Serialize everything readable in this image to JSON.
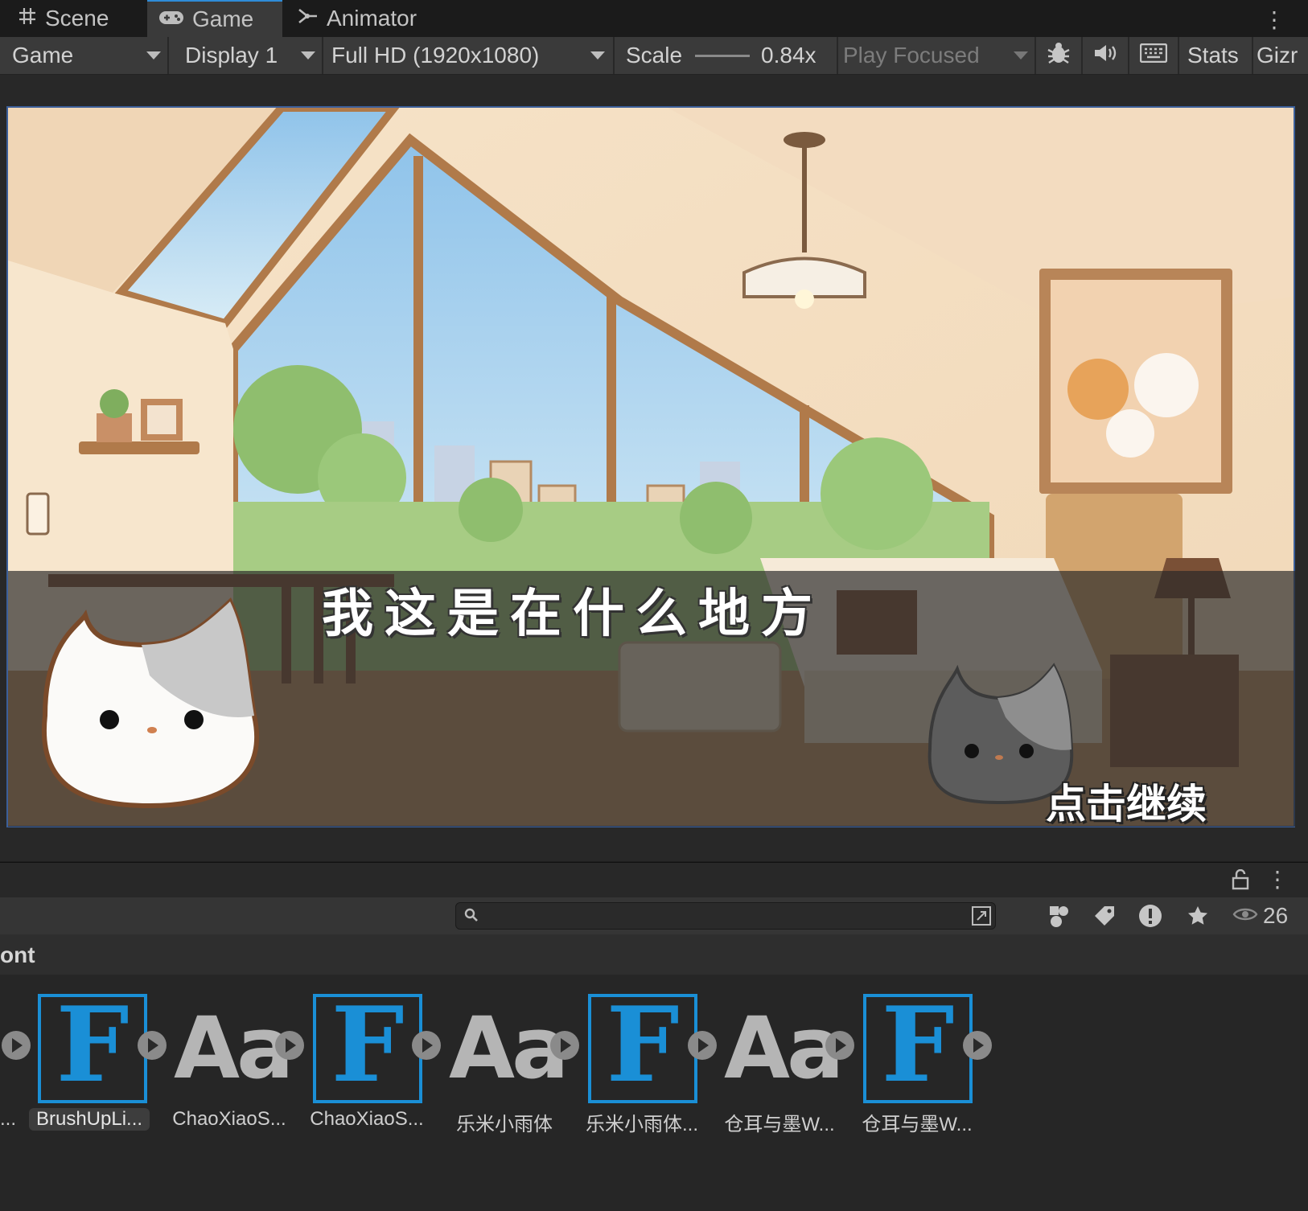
{
  "tabs": [
    {
      "label": "Scene",
      "icon": "hash-icon",
      "active": false
    },
    {
      "label": "Game",
      "icon": "gamepad-icon",
      "active": true
    },
    {
      "label": "Animator",
      "icon": "animator-icon",
      "active": false
    }
  ],
  "toolbar": {
    "view_mode": "Game",
    "display": "Display 1",
    "resolution": "Full HD (1920x1080)",
    "scale_label": "Scale",
    "scale_value": "0.84x",
    "play_mode": "Play Focused",
    "stats_label": "Stats",
    "gizmos_label": "Gizr"
  },
  "game": {
    "dialog_text": "我这是在什么地方",
    "continue_text": "点击继续"
  },
  "project": {
    "search_placeholder": "",
    "hidden_count": "26",
    "breadcrumb": "ont",
    "left_label": "...",
    "assets": [
      {
        "label": "BrushUpLi...",
        "icon": "font-asset-icon",
        "selected": true
      },
      {
        "label": "ChaoXiaoS...",
        "icon": "font-preview-icon",
        "selected": false
      },
      {
        "label": "ChaoXiaoS...",
        "icon": "font-asset-icon",
        "selected": false
      },
      {
        "label": "乐米小雨体",
        "icon": "font-preview-icon",
        "selected": false
      },
      {
        "label": "乐米小雨体...",
        "icon": "font-asset-icon",
        "selected": false
      },
      {
        "label": "仓耳与墨W...",
        "icon": "font-preview-icon",
        "selected": false
      },
      {
        "label": "仓耳与墨W...",
        "icon": "font-asset-icon",
        "selected": false
      }
    ],
    "font_glyph": "F",
    "preview_glyph": "Aa"
  },
  "colors": {
    "accent": "#2f8cd8",
    "font_icon": "#1a8fd6"
  }
}
